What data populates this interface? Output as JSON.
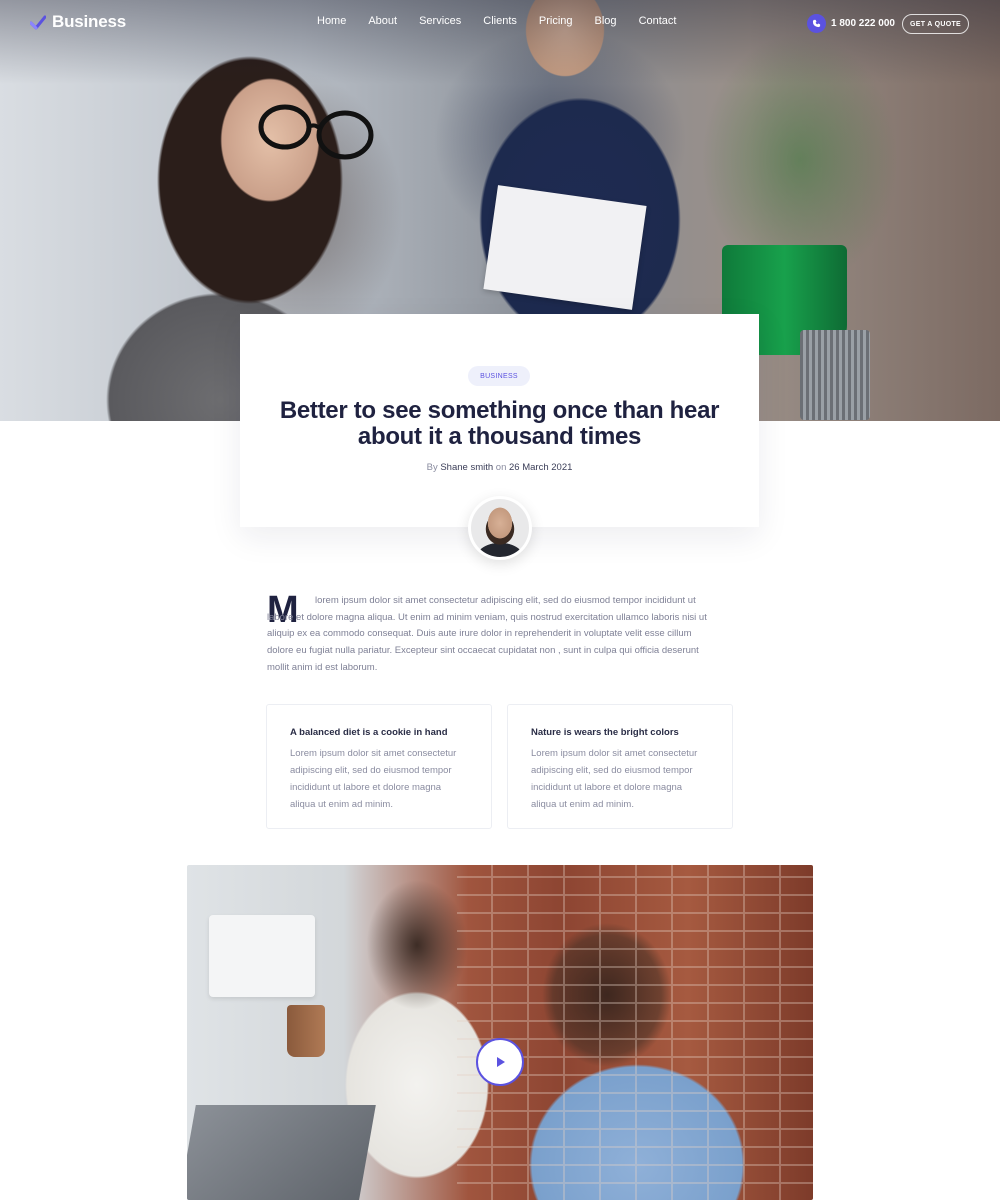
{
  "nav": {
    "logo_text": "Business",
    "links": [
      "Home",
      "About",
      "Services",
      "Clients",
      "Pricing",
      "Blog",
      "Contact"
    ],
    "phone": "1 800 222 000",
    "quote_button": "GET A QUOTE"
  },
  "post": {
    "category": "BUSINESS",
    "title": "Better to see something once than hear about it a thousand times",
    "by_label": "By",
    "author": "Shane smith",
    "on_label": "on",
    "date": "26 March 2021"
  },
  "article": {
    "dropcap": "M",
    "body": "lorem ipsum dolor sit amet consectetur adipiscing elit, sed do eiusmod tempor incididunt ut labore et dolore magna aliqua. Ut enim ad minim veniam, quis nostrud exercitation ullamco laboris nisi ut aliquip ex ea commodo consequat. Duis aute irure dolor in reprehenderit in voluptate velit esse cillum dolore eu fugiat nulla pariatur. Excepteur sint occaecat cupidatat non , sunt in culpa qui officia deserunt mollit anim id est laborum."
  },
  "features": [
    {
      "title": "A balanced diet is a cookie in hand",
      "text": "Lorem ipsum dolor sit amet consectetur adipiscing elit, sed do eiusmod tempor incididunt ut labore et dolore magna aliqua ut enim ad minim."
    },
    {
      "title": "Nature is wears the bright colors",
      "text": "Lorem ipsum dolor sit amet consectetur adipiscing elit, sed do eiusmod tempor incididunt ut labore et dolore magna aliqua ut enim ad minim."
    }
  ],
  "colors": {
    "accent": "#5b52e0",
    "heading": "#1f2240",
    "muted": "#8a8ca0"
  },
  "icons": {
    "logo": "logo-check-icon",
    "phone": "phone-icon",
    "play": "play-icon"
  }
}
